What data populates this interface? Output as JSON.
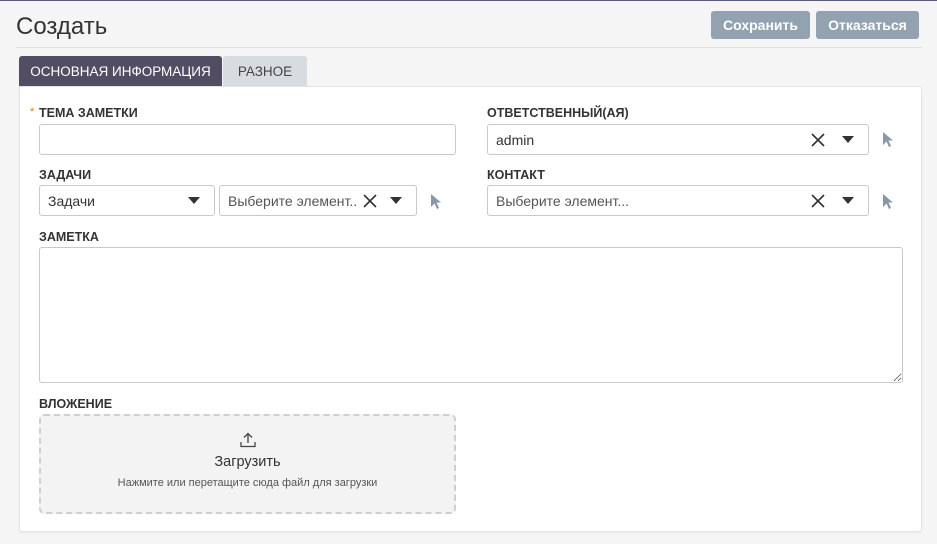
{
  "header": {
    "title": "Создать",
    "save_label": "Сохранить",
    "cancel_label": "Отказаться"
  },
  "tabs": [
    {
      "label": "ОСНОВНАЯ ИНФОРМАЦИЯ",
      "active": true
    },
    {
      "label": "РАЗНОЕ",
      "active": false
    }
  ],
  "form": {
    "subject": {
      "label": "ТЕМА ЗАМЕТКИ",
      "required_mark": "*",
      "value": ""
    },
    "assigned": {
      "label": "ОТВЕТСТВЕННЫЙ(АЯ)",
      "value": "admin"
    },
    "tasks": {
      "label": "ЗАДАЧИ",
      "type_value": "Задачи",
      "placeholder": "Выберите элемент..."
    },
    "contact": {
      "label": "КОНТАКТ",
      "placeholder": "Выберите элемент..."
    },
    "note": {
      "label": "ЗАМЕТКА",
      "value": ""
    },
    "attachment": {
      "label": "ВЛОЖЕНИЕ",
      "upload_title": "Загрузить",
      "upload_hint": "Нажмите или перетащите сюда файл для загрузки"
    }
  },
  "icons": {
    "clear": "close-icon",
    "dropdown": "chevron-down-icon",
    "select": "cursor-pointer-icon",
    "upload": "upload-icon"
  },
  "colors": {
    "button_bg": "#93a2b0",
    "active_tab_bg": "#534d64",
    "inactive_tab_bg": "#d8dce2",
    "required_mark": "#e07b00"
  }
}
